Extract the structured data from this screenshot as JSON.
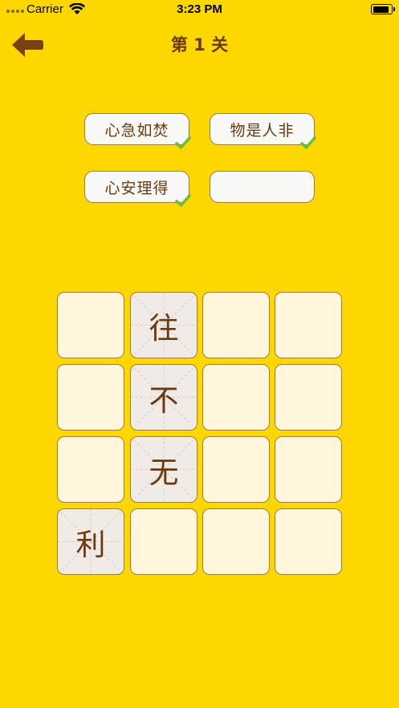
{
  "status_bar": {
    "carrier": "Carrier",
    "time": "3:23 PM"
  },
  "header": {
    "back_icon": "back-arrow-icon",
    "title": "第 1 关"
  },
  "answers": [
    {
      "text": "心急如焚",
      "solved": true
    },
    {
      "text": "物是人非",
      "solved": true
    },
    {
      "text": "心安理得",
      "solved": true
    },
    {
      "text": "",
      "solved": false
    }
  ],
  "grid": {
    "rows": [
      [
        "",
        "往",
        "",
        ""
      ],
      [
        "",
        "不",
        "",
        ""
      ],
      [
        "",
        "无",
        "",
        ""
      ],
      [
        "利",
        "",
        "",
        ""
      ]
    ]
  },
  "colors": {
    "background": "#FFD700",
    "text_brown": "#6B3A10",
    "tile_empty": "#FFF6DC",
    "tile_filled": "#F0EBE6",
    "check_green": "#6DBB3C"
  }
}
